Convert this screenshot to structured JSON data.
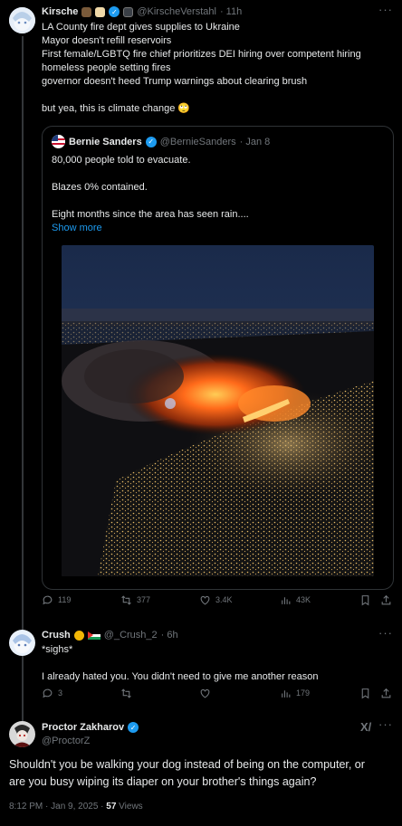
{
  "tweet1": {
    "display_name": "Kirsche",
    "handle": "@KirscheVerstahl",
    "time": "· 11h",
    "lines": [
      "LA County fire dept gives supplies to Ukraine",
      "Mayor doesn't refill reservoirs",
      "First female/LGBTQ fire chief prioritizes DEI hiring over competent hiring",
      "homeless people setting fires",
      "governor doesn't heed Trump warnings about clearing brush",
      "",
      "but yea, this is climate change"
    ],
    "emoji": "🙄"
  },
  "quote": {
    "display_name": "Bernie Sanders",
    "handle": "@BernieSanders",
    "time": "· Jan 8",
    "lines": [
      "80,000 people told to evacuate.",
      "",
      "Blazes 0% contained.",
      "",
      "Eight months since the area has seen rain...."
    ],
    "show_more": "Show more"
  },
  "tweet1_actions": {
    "replies": "119",
    "reposts": "377",
    "likes": "3.4K",
    "views": "43K"
  },
  "tweet2": {
    "display_name": "Crush",
    "handle": "@_Crush_2",
    "time": "· 6h",
    "line1": "*sighs*",
    "line2": "I already hated you. You didn't need to give me another reason"
  },
  "tweet2_actions": {
    "replies": "3",
    "reposts": "",
    "likes": "",
    "views": "179"
  },
  "tweet3": {
    "display_name": "Proctor Zakharov",
    "handle": "@ProctorZ",
    "line1": "Shouldn't you be walking your dog instead of being on the computer, or",
    "line2": "are you busy wiping its diaper on your brother's things again?",
    "timestamp": "8:12 PM · Jan 9, 2025 · ",
    "views": "57",
    "views_label": " Views"
  },
  "colors": {
    "background": "#000000",
    "text": "#e7e9ea",
    "muted": "#71767b",
    "accent": "#1d9bf0",
    "border": "#2f3336"
  }
}
